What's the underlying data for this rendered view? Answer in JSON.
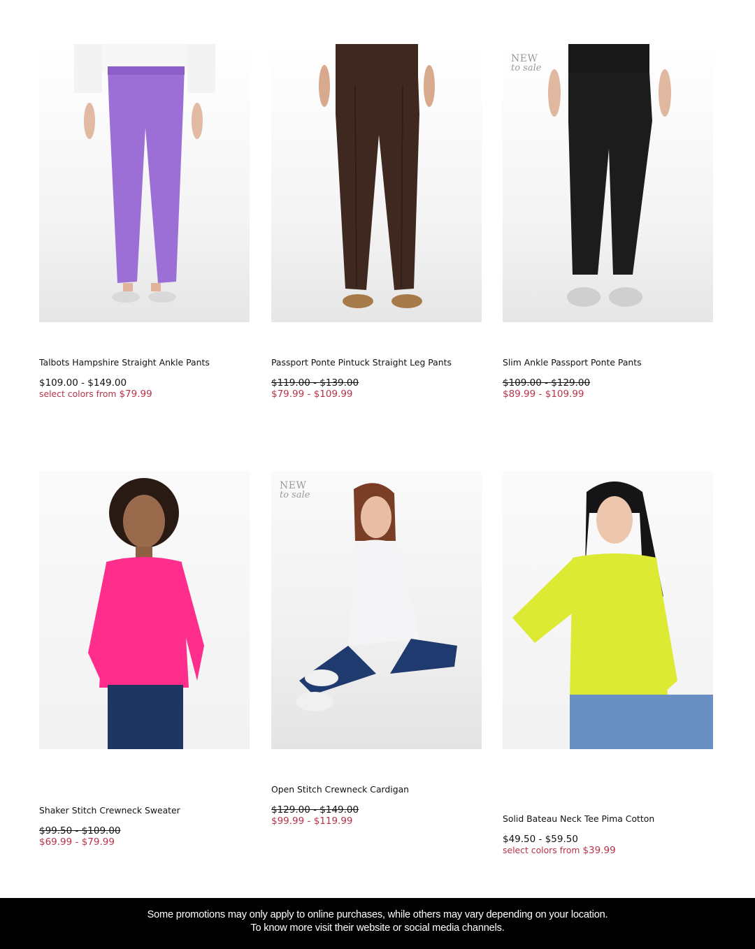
{
  "products": [
    {
      "name": "Talbots Hampshire Straight Ankle Pants",
      "price": "$109.00 - $149.00",
      "sale_note": "select colors from",
      "sale_note_price": "$79.99",
      "badge": null
    },
    {
      "name": "Passport Ponte Pintuck Straight Leg Pants",
      "original_price": "$119.00 - $139.00",
      "sale_price": "$79.99 - $109.99",
      "badge": null
    },
    {
      "name": "Slim Ankle Passport Ponte Pants",
      "original_price": "$109.00 - $129.00",
      "sale_price": "$89.99 - $109.99",
      "badge": {
        "line1": "NEW",
        "line2": "to sale"
      }
    },
    {
      "name": "Shaker Stitch Crewneck Sweater",
      "original_price": "$99.50 - $109.00",
      "sale_price": "$69.99 - $79.99",
      "badge": null
    },
    {
      "name": "Open Stitch Crewneck Cardigan",
      "original_price": "$129.00 - $149.00",
      "sale_price": "$99.99 - $119.99",
      "badge": {
        "line1": "NEW",
        "line2": "to sale"
      }
    },
    {
      "name": "Solid Bateau Neck Tee Pima Cotton",
      "price": "$49.50 - $59.50",
      "sale_note": "select colors from",
      "sale_note_price": "$39.99",
      "badge": null
    }
  ],
  "footer": {
    "line1": "Some promotions may only apply to online purchases, while others may vary depending on your location.",
    "line2": "To know more visit their website or social media channels."
  },
  "colors": {
    "sale": "#b8324a",
    "footer_bg": "#000000"
  },
  "product_colors": [
    "purple",
    "brown",
    "black",
    "hot pink",
    "white",
    "lime yellow"
  ]
}
